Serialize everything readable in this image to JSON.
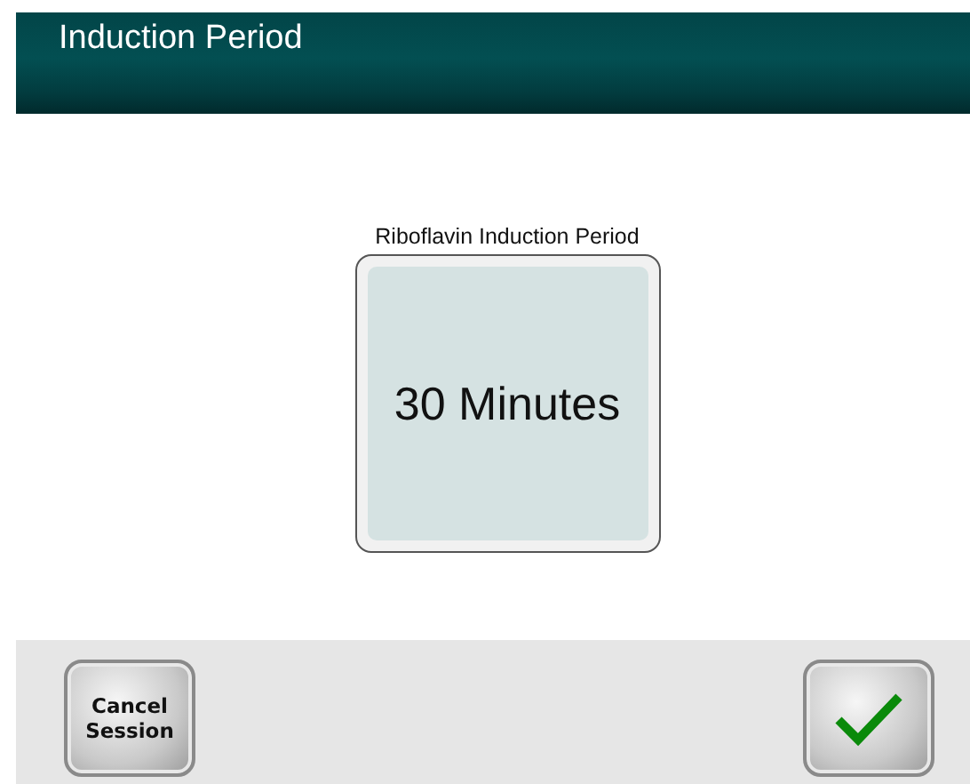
{
  "header": {
    "title": "Induction Period"
  },
  "setting": {
    "label": "Riboflavin Induction Period",
    "value": "30 Minutes"
  },
  "footer": {
    "cancel_button": "Cancel\nSession",
    "confirm_button": {
      "kind": "check"
    }
  }
}
